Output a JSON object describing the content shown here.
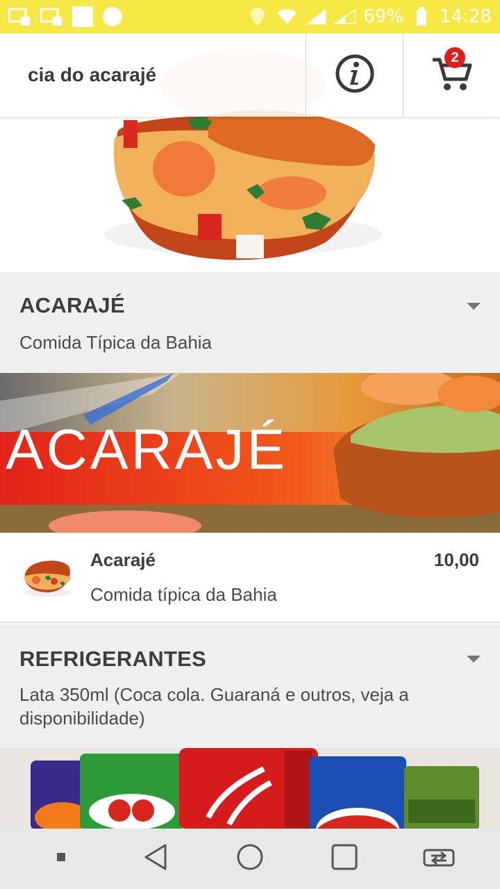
{
  "status_bar": {
    "battery": "69%",
    "time": "14:28"
  },
  "header": {
    "title": "cia do acarajé",
    "cart_count": "2"
  },
  "categories": [
    {
      "title": "ACARAJÉ",
      "description": "Comida Típica da Bahia",
      "banner_text": "ACARAJÉ"
    },
    {
      "title": "REFRIGERANTES",
      "description": "Lata 350ml (Coca cola. Guaraná e outros, veja a disponibilidade)"
    }
  ],
  "products": [
    {
      "name": "Acarajé",
      "price": "10,00",
      "description": "Comida típica da Bahia"
    }
  ],
  "colors": {
    "status_bar": "#f8e845",
    "badge": "#e31b1b",
    "category_bg": "#efefef"
  },
  "icons": {
    "info": "info-icon",
    "cart": "cart-icon"
  }
}
